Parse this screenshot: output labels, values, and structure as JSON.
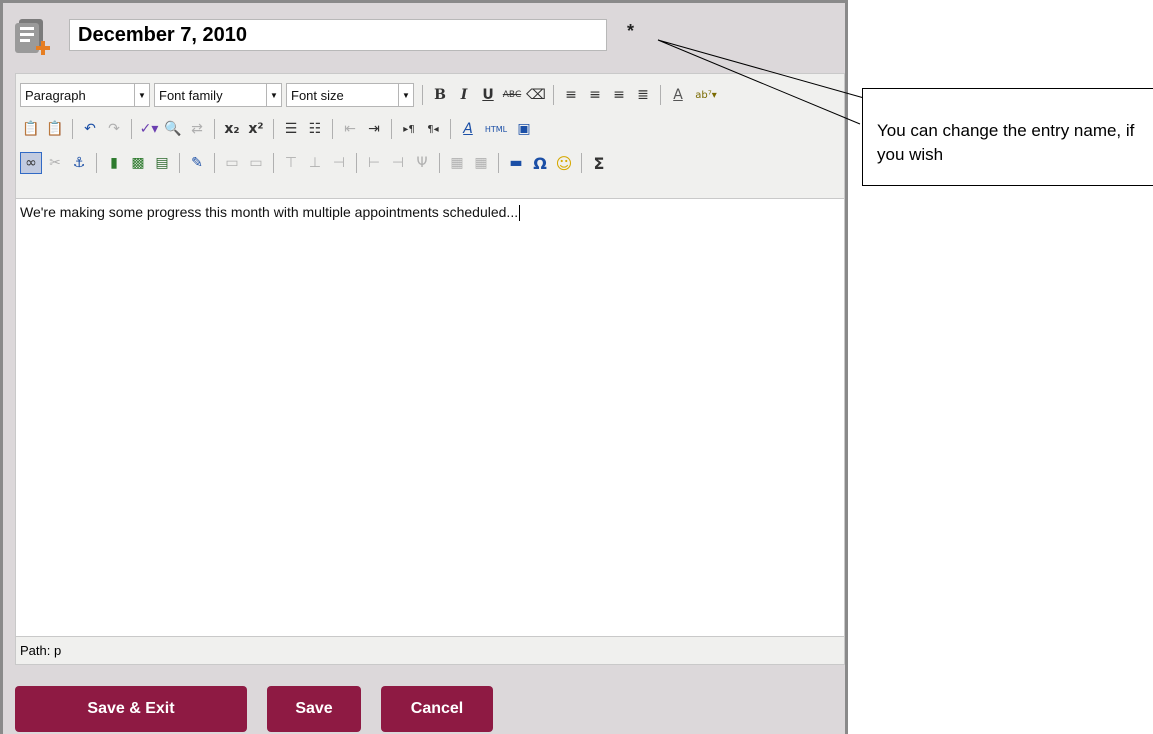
{
  "title_input": {
    "value": "December 7, 2010"
  },
  "required_marker": "*",
  "toolbar": {
    "format_select": "Paragraph",
    "font_family_select": "Font family",
    "font_size_select": "Font size",
    "html_label": "HTML"
  },
  "editor_content": "We're making some progress this month with multiple appointments scheduled...",
  "status": {
    "path": "Path: p"
  },
  "buttons": {
    "save_exit": "Save & Exit",
    "save": "Save",
    "cancel": "Cancel"
  },
  "callout": {
    "text": "You can change the entry name, if you wish"
  },
  "colors": {
    "button": "#8e1a43",
    "frame": "#dcd8da",
    "toolbar": "#f0f0ee"
  }
}
